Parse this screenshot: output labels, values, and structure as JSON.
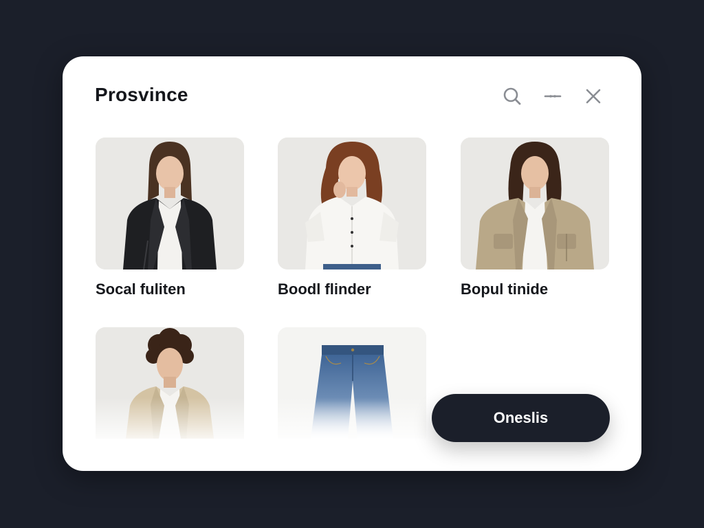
{
  "app": {
    "title": "Prosvince"
  },
  "header": {
    "icons": [
      "search-icon",
      "minimize-icon",
      "close-icon"
    ]
  },
  "products": [
    {
      "name": "Socal fuliten",
      "image": "model in black leather jacket"
    },
    {
      "name": "Boodl flinder",
      "image": "model in white short-sleeve shirt"
    },
    {
      "name": "Bopul tinide",
      "image": "model in beige utility jacket"
    },
    {
      "name": "",
      "image": "model in cream overshirt"
    },
    {
      "name": "",
      "image": "light wash denim jeans"
    }
  ],
  "cta": {
    "label": "Oneslis"
  },
  "colors": {
    "background": "#1b1f2a",
    "panel": "#ffffff",
    "button": "#1b1f2a",
    "text": "#15171c"
  }
}
